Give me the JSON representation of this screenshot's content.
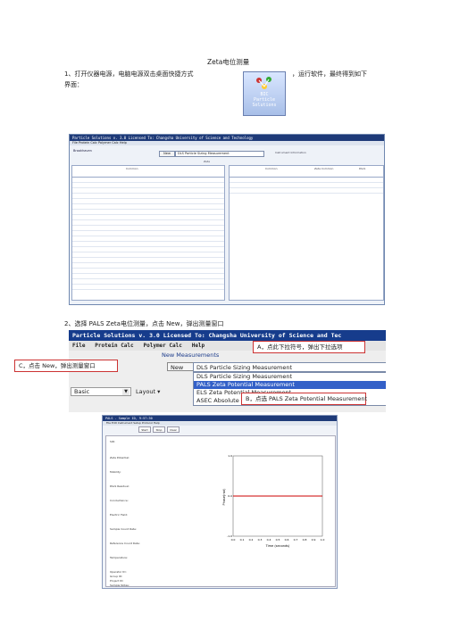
{
  "doc": {
    "title": "Zeta电位测量",
    "step1_part1": "1、打开仪器电源，电脑电源双击桌面快捷方式",
    "step1_part2": "，运行软件，最终得到如下",
    "step1_part3": "界面：",
    "step2": "2、选择    PALS Zeta电位测量，点击      New，弹出测量窗口"
  },
  "desktop_icon": {
    "label_line1": "BIC",
    "label_line2": "Particle",
    "label_line3": "Solutions"
  },
  "screenshot1": {
    "titlebar": "Particle Solutions v. 3.0    Licensed To: Changsha University of Science and Technology",
    "menu": "File  Protein Calc  Polymer Calc  Help",
    "new_label": "New",
    "selected_measurement": "DLS Particle Sizing Measurement",
    "header_right": "Instrument Information",
    "zeta_label": "Zeta",
    "panel_left_header": "Common",
    "panel_right_headers": [
      "Common",
      "Zeta Common",
      "PALS"
    ]
  },
  "screenshot2": {
    "titlebar": "Particle Solutions v. 3.0     Licensed To: Changsha University of Science and Tec",
    "menu_items": [
      "File",
      "Protein Calc",
      "Polymer Calc",
      "Help"
    ],
    "new_measurements_label": "New Measurements",
    "new_button": "New",
    "selected_option": "DLS Particle Sizing Measurement",
    "options": [
      "DLS Particle Sizing Measurement",
      "PALS Zeta Potential Measurement",
      "ELS Zeta Potential Measurement",
      "ASEC Absolute Size Exclusion"
    ],
    "highlighted_index": 1,
    "basic_select": "Basic",
    "layout_label": "Layout",
    "highlight_color": "#3360c8"
  },
  "callouts": {
    "a": "A，点此下拉符号，弹出下拉选项",
    "c": "C，点击   New，弹出测量窗口",
    "b": "B，点选    PALS Zeta Potential Measurement"
  },
  "screenshot3": {
    "titlebar": "PALS - Sample ID, 9:57:30",
    "menu": "File  Edit  Instrument  Setup  Protocol  Help",
    "toolbar": [
      "Start",
      "Stop",
      "Clear"
    ],
    "sample_id": "SID:",
    "fields": [
      "Zeta Potential:",
      "Mobility:",
      "PALS Residual:",
      "Conductance:",
      "Electric Field:",
      "Sample Count Rate:",
      "Reference Count Rate:",
      "Temperature:"
    ],
    "operator": "Operator ID:",
    "group": "Group ID:",
    "project": "Project ID:",
    "notes": "Sample Notes:",
    "chart_ylabel": "Phase(rad)",
    "chart_xlabel": "Time (seconds)",
    "chart_line_color": "#cc0000"
  },
  "chart_data": {
    "type": "line",
    "xlabel": "Time (seconds)",
    "ylabel": "Phase(rad)",
    "x": [
      0,
      0.1,
      0.2,
      0.3,
      0.4,
      0.5,
      0.6,
      0.7,
      0.8,
      0.9,
      1.0
    ],
    "series": [
      {
        "values": [
          0,
          0,
          0,
          0,
          0,
          0,
          0,
          0,
          0,
          0,
          0
        ]
      }
    ],
    "xlim": [
      0,
      1.0
    ],
    "ylim": [
      -1.0,
      1.0
    ],
    "grid": false
  }
}
